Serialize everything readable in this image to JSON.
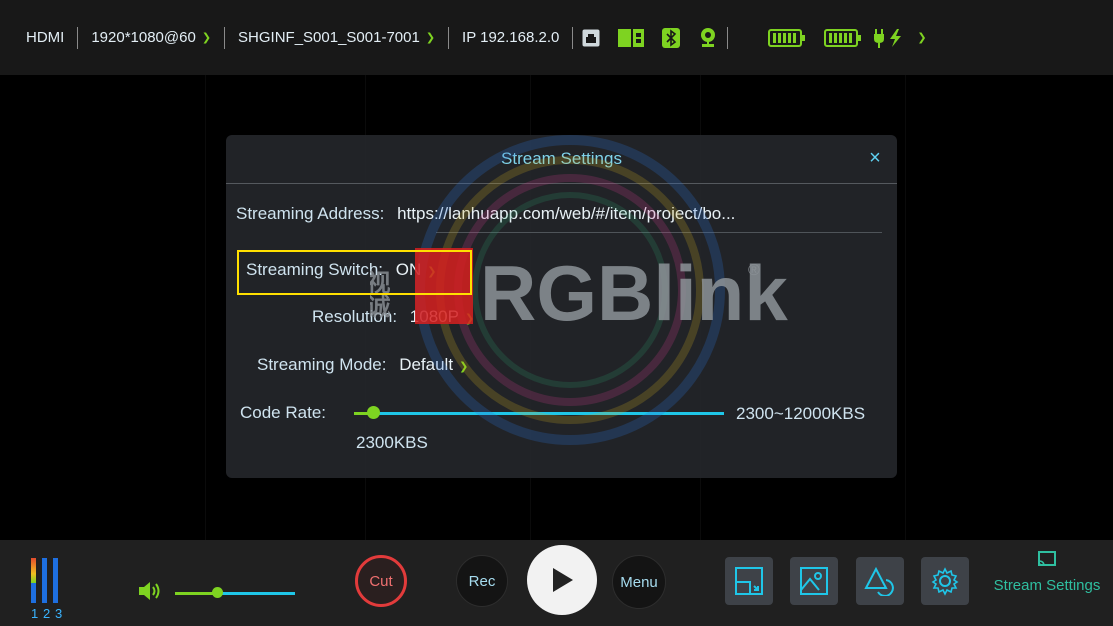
{
  "topbar": {
    "input": "HDMI",
    "format": "1920*1080@60",
    "device_id": "SHGINF_S001_S001-7001",
    "ip": "IP 192.168.2.0",
    "icons": [
      "ethernet-icon",
      "sd-card-icon",
      "bluetooth-icon",
      "webcam-icon",
      "battery-icon",
      "battery-icon",
      "power-charging-icon"
    ]
  },
  "watermark": {
    "brand": "RGBlink",
    "registered": "®",
    "cn_chars": "视诚"
  },
  "dialog": {
    "title": "Stream Settings",
    "close": "×",
    "address_label": "Streaming Address:",
    "address_value": "https://lanhuapp.com/web/#/item/project/bo...",
    "switch_label": "Streaming Switch:",
    "switch_value": "ON",
    "resolution_label": "Resolution:",
    "resolution_value": "1080P",
    "mode_label": "Streaming Mode:",
    "mode_value": "Default",
    "rate_label": "Code Rate:",
    "rate_range": "2300~12000KBS",
    "rate_value": "2300KBS",
    "rate_fraction": 0.05
  },
  "bottombar": {
    "meter_labels": [
      "1",
      "2",
      "3"
    ],
    "volume_fraction": 0.35,
    "cut_label": "Cut",
    "rec_label": "Rec",
    "menu_label": "Menu",
    "stream_settings_label": "Stream Settings",
    "colors": {
      "accent": "#7ed321",
      "cyan": "#1fc6e8",
      "cut_red": "#e23b3b",
      "green_label": "#2fbfa0"
    }
  }
}
